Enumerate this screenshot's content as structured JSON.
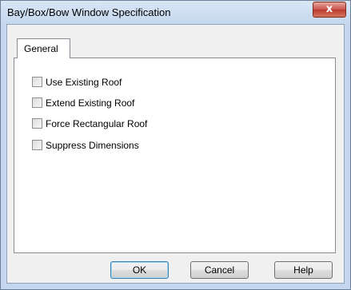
{
  "window": {
    "title": "Bay/Box/Bow Window Specification",
    "close_glyph": "x"
  },
  "tabs": [
    {
      "label": "General",
      "selected": true
    }
  ],
  "checkboxes": [
    {
      "label": "Use Existing Roof",
      "checked": false
    },
    {
      "label": "Extend Existing Roof",
      "checked": false
    },
    {
      "label": "Force Rectangular Roof",
      "checked": false
    },
    {
      "label": "Suppress Dimensions",
      "checked": false
    }
  ],
  "buttons": {
    "ok": "OK",
    "cancel": "Cancel",
    "help": "Help"
  },
  "colors": {
    "frame": "#c4d7ee",
    "close": "#c75050",
    "default_button_border": "#3c7fb1"
  },
  "icons": [
    "close-icon"
  ]
}
